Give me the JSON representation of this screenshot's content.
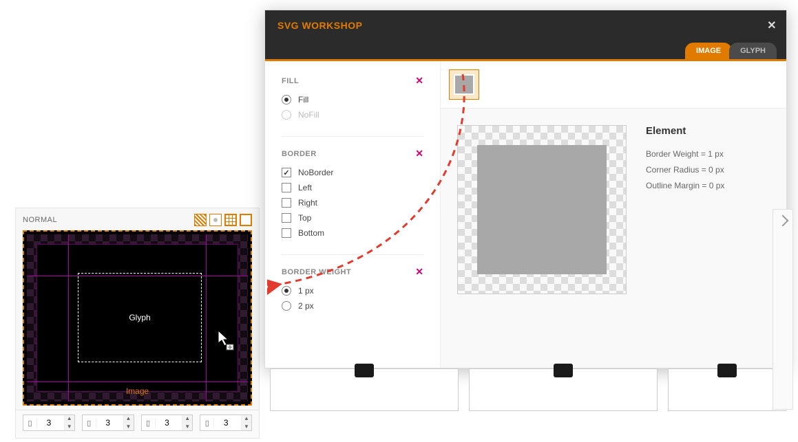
{
  "left": {
    "preview_label": "NORMAL",
    "glyph_label": "Glyph",
    "image_label": "Image",
    "spinner_value": "3"
  },
  "modal": {
    "title": "SVG WORKSHOP",
    "tabs": {
      "image": "IMAGE",
      "glyph": "GLYPH"
    },
    "sections": {
      "fill": {
        "title": "FILL",
        "options": {
          "fill": "Fill",
          "nofill": "NoFill"
        }
      },
      "border": {
        "title": "BORDER",
        "options": {
          "noborder": "NoBorder",
          "left": "Left",
          "right": "Right",
          "top": "Top",
          "bottom": "Bottom"
        }
      },
      "border_weight": {
        "title": "BORDER WEIGHT",
        "options": {
          "one": "1 px",
          "two": "2 px"
        }
      }
    },
    "info": {
      "title": "Element",
      "lines": {
        "bw": "Border Weight = 1 px",
        "cr": "Corner Radius = 0 px",
        "om": "Outline Margin = 0 px"
      }
    }
  }
}
